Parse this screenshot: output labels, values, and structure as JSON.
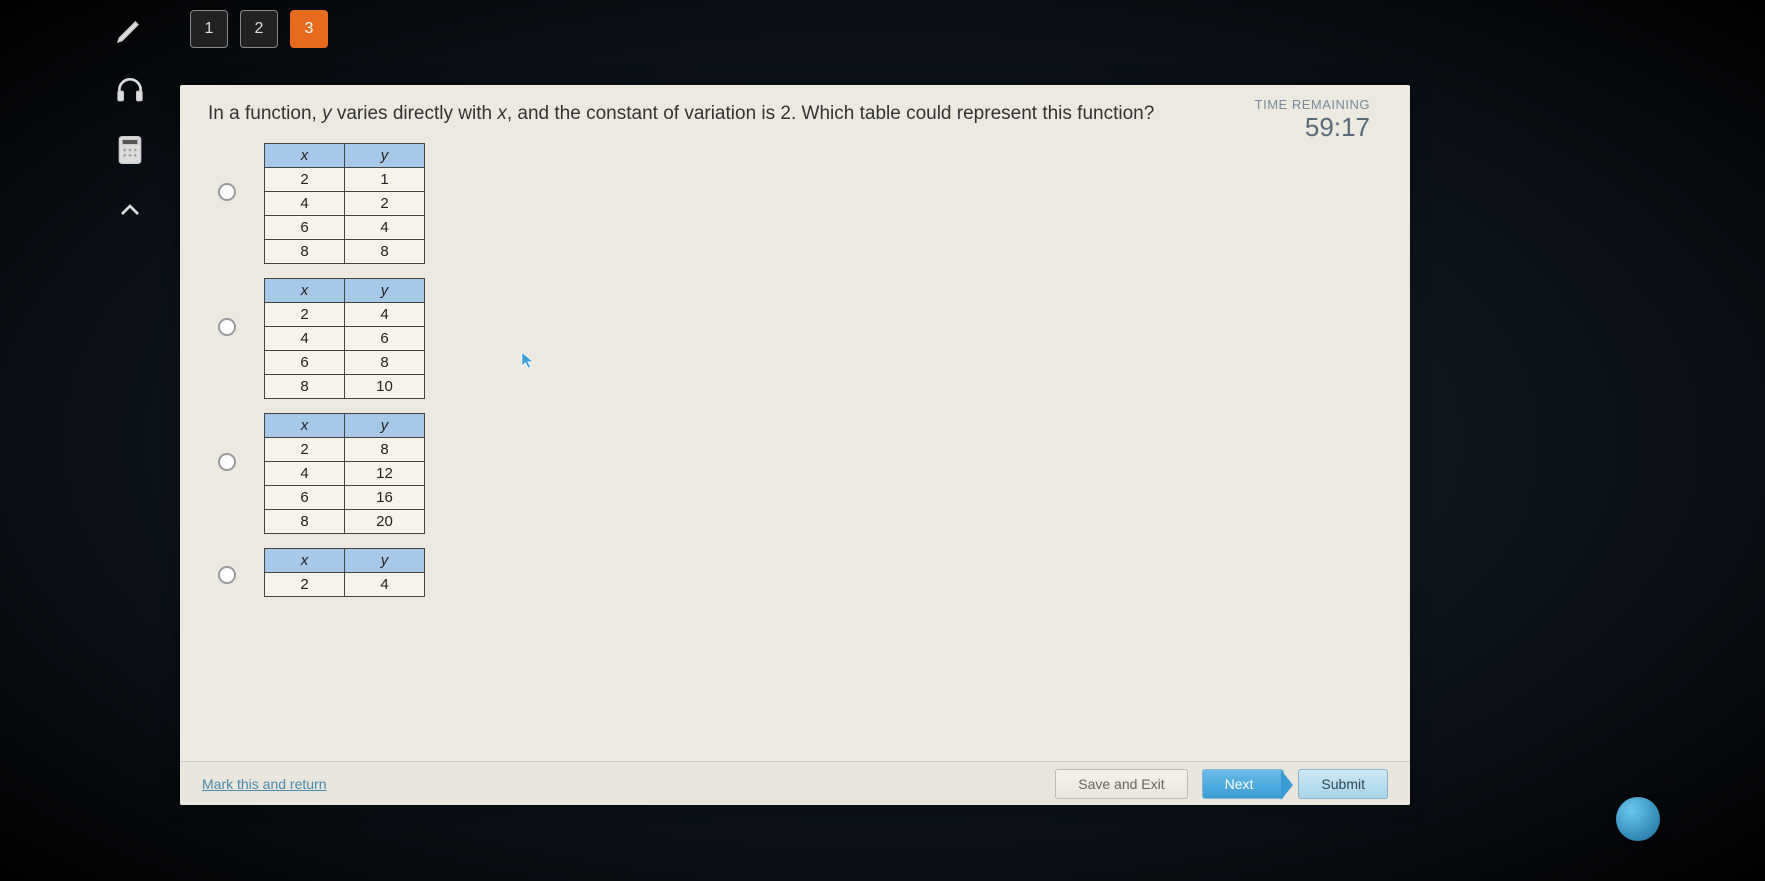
{
  "nav": {
    "items": [
      "1",
      "2",
      "3"
    ],
    "active_index": 2
  },
  "timer": {
    "label": "TIME REMAINING",
    "value": "59:17"
  },
  "question": {
    "text_before_y": "In a function, ",
    "y": "y",
    "text_mid": " varies directly with ",
    "x": "x",
    "text_after": ", and the constant of variation is 2. Which table could represent this function?"
  },
  "headers": {
    "x": "x",
    "y": "y"
  },
  "options": [
    {
      "rows": [
        [
          "2",
          "1"
        ],
        [
          "4",
          "2"
        ],
        [
          "6",
          "4"
        ],
        [
          "8",
          "8"
        ]
      ]
    },
    {
      "rows": [
        [
          "2",
          "4"
        ],
        [
          "4",
          "6"
        ],
        [
          "6",
          "8"
        ],
        [
          "8",
          "10"
        ]
      ]
    },
    {
      "rows": [
        [
          "2",
          "8"
        ],
        [
          "4",
          "12"
        ],
        [
          "6",
          "16"
        ],
        [
          "8",
          "20"
        ]
      ]
    },
    {
      "rows": [
        [
          "2",
          "4"
        ]
      ]
    }
  ],
  "footer": {
    "mark": "Mark this and return",
    "save": "Save and Exit",
    "next": "Next",
    "submit": "Submit"
  }
}
